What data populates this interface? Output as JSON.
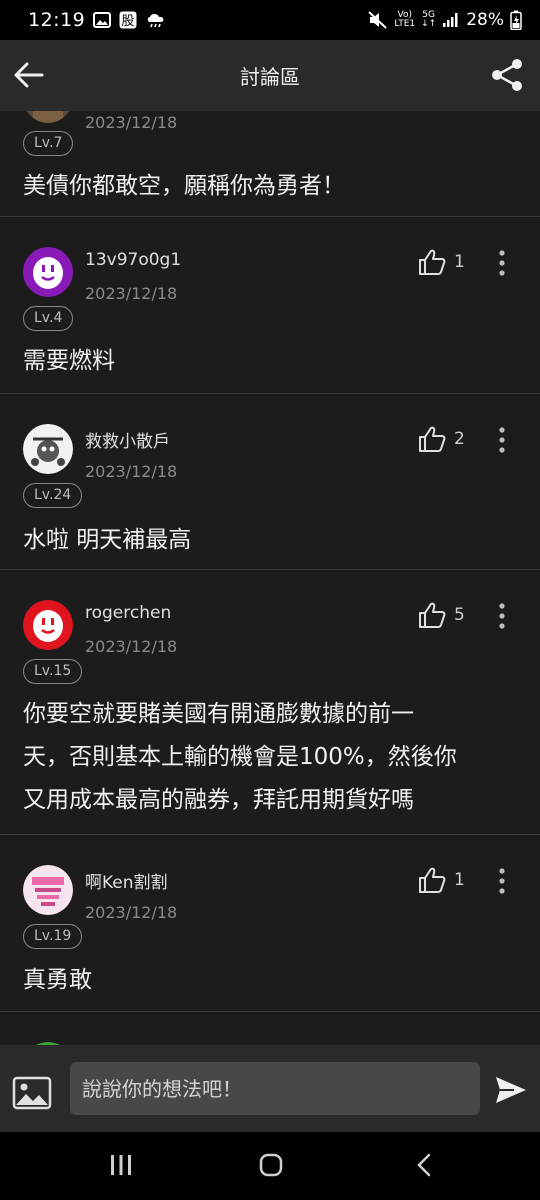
{
  "status_bar": {
    "time": "12:19",
    "net_top": "Vo)",
    "net_bottom": "LTE1",
    "five_g_top": "5G",
    "five_g_bottom": "↓↑",
    "battery": "28%"
  },
  "app_bar": {
    "title": "討論區"
  },
  "posts": [
    {
      "date": "2023/12/18",
      "level": "Lv.7",
      "text": "美債你都敢空，願稱你為勇者！"
    },
    {
      "username": "13v97o0g1",
      "date": "2023/12/18",
      "level": "Lv.4",
      "likes": "1",
      "text": "需要燃料",
      "avatar_color": "#8a1ab8"
    },
    {
      "username": "救救小散戶",
      "date": "2023/12/18",
      "level": "Lv.24",
      "likes": "2",
      "text": "水啦 明天補最高"
    },
    {
      "username": "rogerchen",
      "date": "2023/12/18",
      "level": "Lv.15",
      "likes": "5",
      "text_lines": [
        "你要空就要賭美國有開通膨數據的前一",
        "天，否則基本上輸的機會是100%，然後你",
        "又用成本最高的融券，拜託用期貨好嗎"
      ],
      "avatar_color": "#e0141e"
    },
    {
      "username": "啊Ken割割",
      "date": "2023/12/18",
      "level": "Lv.19",
      "likes": "1",
      "text": "真勇敢"
    }
  ],
  "input": {
    "placeholder": "說說你的想法吧！"
  },
  "colors": {
    "background": "#1c1c1c",
    "bar": "#2a2a2a",
    "input": "#484848",
    "divider": "#3a3a3a"
  }
}
